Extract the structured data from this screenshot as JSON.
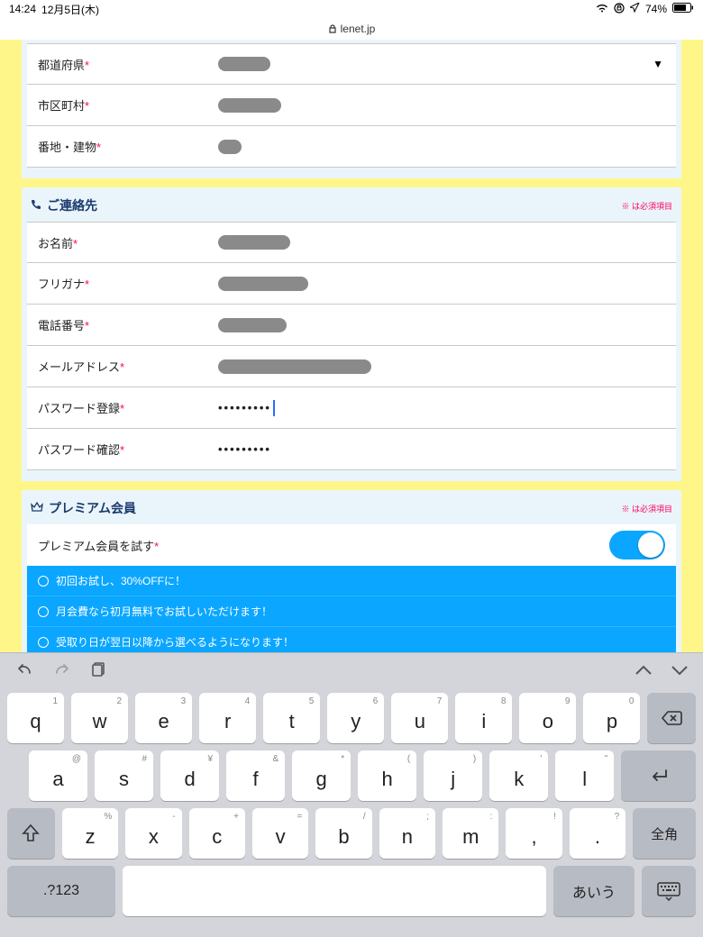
{
  "status": {
    "time": "14:24",
    "date": "12月5日(木)",
    "battery": "74%"
  },
  "url": "lenet.jp",
  "required_note": "※ は必須項目",
  "address": {
    "rows": [
      {
        "label": "都道府県",
        "smudge_w": 58,
        "dropdown": true
      },
      {
        "label": "市区町村",
        "smudge_w": 70
      },
      {
        "label": "番地・建物",
        "smudge_w": 26
      }
    ]
  },
  "contact": {
    "title": "ご連絡先",
    "rows": [
      {
        "label": "お名前",
        "smudge_w": 80
      },
      {
        "label": "フリガナ",
        "smudge_w": 100
      },
      {
        "label": "電話番号",
        "smudge_w": 76
      },
      {
        "label": "メールアドレス",
        "smudge_w": 170
      },
      {
        "label": "パスワード登録",
        "password": "•••••••••",
        "cursor": true
      },
      {
        "label": "パスワード確認",
        "password": "•••••••••"
      }
    ]
  },
  "premium": {
    "title": "プレミアム会員",
    "try_label": "プレミアム会員を試す",
    "toggle_on": true,
    "benefits": [
      "初回お試し、30%OFFに！",
      "月会費なら初月無料でお試しいただけます！",
      "受取り日が翌日以降から選べるようになります！"
    ]
  },
  "keyboard": {
    "row1": [
      {
        "s": "1",
        "m": "q"
      },
      {
        "s": "2",
        "m": "w"
      },
      {
        "s": "3",
        "m": "e"
      },
      {
        "s": "4",
        "m": "r"
      },
      {
        "s": "5",
        "m": "t"
      },
      {
        "s": "6",
        "m": "y"
      },
      {
        "s": "7",
        "m": "u"
      },
      {
        "s": "8",
        "m": "i"
      },
      {
        "s": "9",
        "m": "o"
      },
      {
        "s": "0",
        "m": "p"
      }
    ],
    "row2": [
      {
        "s": "@",
        "m": "a"
      },
      {
        "s": "#",
        "m": "s"
      },
      {
        "s": "¥",
        "m": "d"
      },
      {
        "s": "&",
        "m": "f"
      },
      {
        "s": "*",
        "m": "g"
      },
      {
        "s": "(",
        "m": "h"
      },
      {
        "s": ")",
        "m": "j"
      },
      {
        "s": "'",
        "m": "k"
      },
      {
        "s": "\"",
        "m": "l"
      }
    ],
    "row3": [
      {
        "s": "%",
        "m": "z"
      },
      {
        "s": "-",
        "m": "x"
      },
      {
        "s": "+",
        "m": "c"
      },
      {
        "s": "=",
        "m": "v"
      },
      {
        "s": "/",
        "m": "b"
      },
      {
        "s": ";",
        "m": "n"
      },
      {
        "s": ":",
        "m": "m"
      },
      {
        "s": "!",
        "m": ","
      },
      {
        "s": "?",
        "m": "."
      }
    ],
    "zenkaku": "全角",
    "numsym": ".?123",
    "aiu": "あいう"
  }
}
